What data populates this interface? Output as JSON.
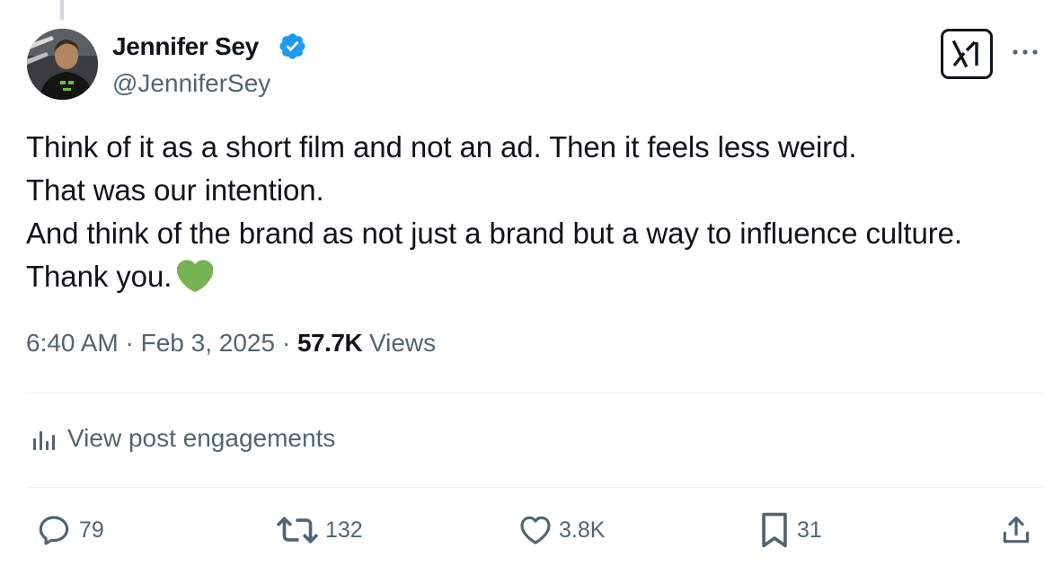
{
  "author": {
    "name": "Jennifer Sey",
    "handle": "@JenniferSey",
    "verified": true,
    "badge_color": "#1d9bf0"
  },
  "post": {
    "lines": [
      "Think of it as a short film and not an ad. Then it feels less weird.",
      "That was our intention.",
      "And think of the brand as not just a brand but a way to influence culture.",
      "Thank you."
    ],
    "emoji": "green-heart",
    "emoji_color": "#77b255"
  },
  "meta": {
    "time": "6:40 AM",
    "separator": "·",
    "date": "Feb 3, 2025",
    "views_count": "57.7K",
    "views_label": "Views"
  },
  "engagements_label": "View post engagements",
  "actions": {
    "replies": "79",
    "reposts": "132",
    "likes": "3.8K",
    "bookmarks": "31"
  },
  "icons": [
    "verified-badge-icon",
    "grok-icon",
    "more-icon",
    "analytics-icon",
    "reply-icon",
    "repost-icon",
    "like-icon",
    "bookmark-icon",
    "share-icon"
  ]
}
